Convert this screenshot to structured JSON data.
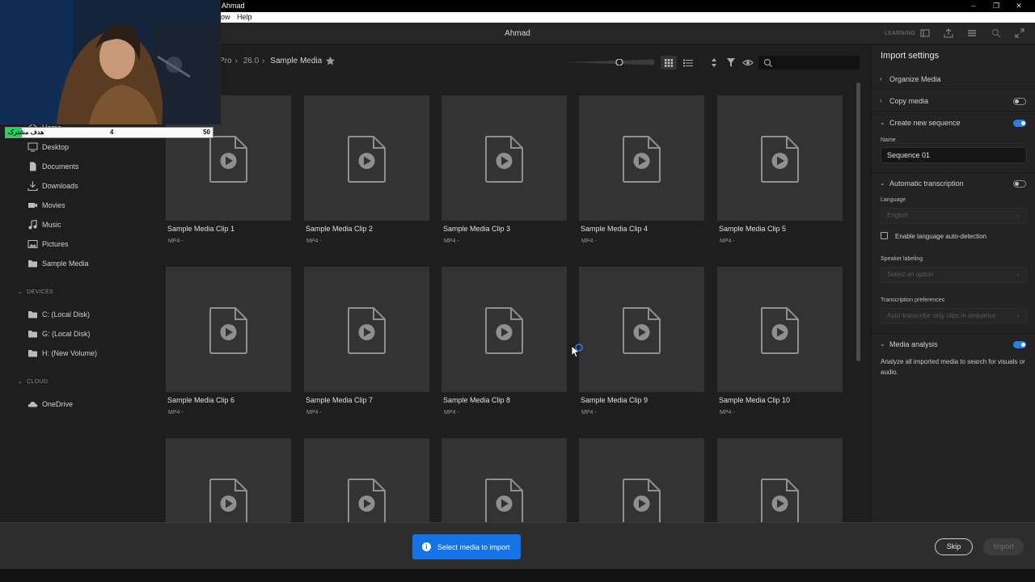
{
  "os_window": {
    "title": "Ahmad",
    "menu": [
      "ow",
      "Help"
    ]
  },
  "app_header": {
    "user": "Ahmad",
    "learning": "LEARNING"
  },
  "breadcrumb": [
    "Pro",
    "26.0",
    "Sample Media"
  ],
  "sidebar": {
    "places": [
      {
        "label": "Home",
        "icon": "home-icon"
      },
      {
        "label": "Desktop",
        "icon": "desktop-icon"
      },
      {
        "label": "Documents",
        "icon": "document-icon"
      },
      {
        "label": "Downloads",
        "icon": "download-icon"
      },
      {
        "label": "Movies",
        "icon": "camera-icon"
      },
      {
        "label": "Music",
        "icon": "music-icon"
      },
      {
        "label": "Pictures",
        "icon": "image-icon"
      },
      {
        "label": "Sample Media",
        "icon": "folder-icon"
      }
    ],
    "devices_label": "DEVICES",
    "devices": [
      {
        "label": "C: (Local Disk)",
        "icon": "folder-icon"
      },
      {
        "label": "G: (Local Disk)",
        "icon": "folder-icon"
      },
      {
        "label": "H: (New Volume)",
        "icon": "folder-icon"
      }
    ],
    "cloud_label": "CLOUD",
    "cloud": [
      {
        "label": "OneDrive",
        "icon": "cloud-icon"
      }
    ]
  },
  "clips": [
    {
      "name": "Sample Media Clip 1",
      "meta": "MP4 -"
    },
    {
      "name": "Sample Media Clip 2",
      "meta": "MP4 -"
    },
    {
      "name": "Sample Media Clip 3",
      "meta": "MP4 -"
    },
    {
      "name": "Sample Media Clip 4",
      "meta": "MP4 -"
    },
    {
      "name": "Sample Media Clip 5",
      "meta": "MP4 -"
    },
    {
      "name": "Sample Media Clip 6",
      "meta": "MP4 -"
    },
    {
      "name": "Sample Media Clip 7",
      "meta": "MP4 -"
    },
    {
      "name": "Sample Media Clip 8",
      "meta": "MP4 -"
    },
    {
      "name": "Sample Media Clip 9",
      "meta": "MP4 -"
    },
    {
      "name": "Sample Media Clip 10",
      "meta": "MP4 -"
    },
    {
      "name": "",
      "meta": ""
    },
    {
      "name": "",
      "meta": ""
    },
    {
      "name": "",
      "meta": ""
    },
    {
      "name": "",
      "meta": ""
    },
    {
      "name": "",
      "meta": ""
    }
  ],
  "import_settings": {
    "title": "Import settings",
    "organize_media": "Organize Media",
    "copy_media": "Copy media",
    "copy_media_on": false,
    "create_sequence": "Create new sequence",
    "create_sequence_on": true,
    "name_label": "Name",
    "sequence_name": "Sequence 01",
    "auto_transcription": "Automatic transcription",
    "auto_transcription_on": false,
    "language_label": "Language",
    "language_value": "English",
    "auto_detect_label": "Enable language auto-detection",
    "auto_detect_checked": false,
    "speaker_label": "Speaker labeling",
    "speaker_placeholder": "Select an option",
    "prefs_label": "Transcription preferences",
    "prefs_value": "Auto-transcribe only clips in sequence",
    "media_analysis": "Media analysis",
    "media_analysis_on": true,
    "media_analysis_desc": "Analyze all imported media to search for visuals or audio."
  },
  "footer": {
    "toast": "Select media to import",
    "skip": "Skip",
    "import": "Import"
  },
  "goal_overlay": {
    "title": "هدف مشترک",
    "current": 4,
    "target": 50,
    "progress": 0.08
  },
  "colors": {
    "accent": "#1473e6",
    "toggle_on": "#2680eb",
    "goal_fill": "#1ed760"
  }
}
